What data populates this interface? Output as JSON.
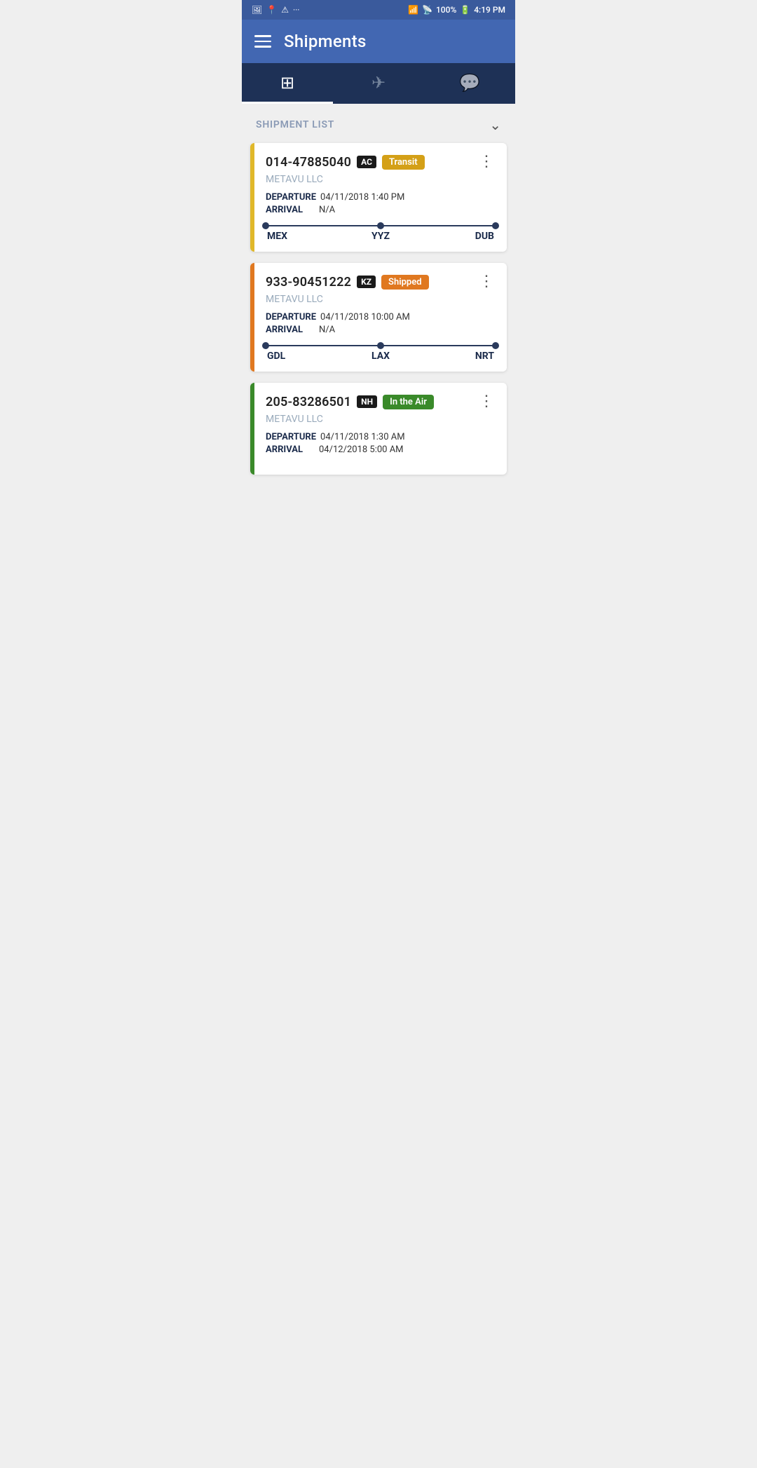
{
  "statusBar": {
    "time": "4:19 PM",
    "battery": "100%",
    "icons": [
      "image-icon",
      "location-icon",
      "warning-icon",
      "more-icon"
    ]
  },
  "header": {
    "title": "Shipments",
    "menuIcon": "hamburger-icon"
  },
  "tabs": [
    {
      "id": "dashboard",
      "icon": "grid-icon",
      "label": "Dashboard",
      "active": true
    },
    {
      "id": "flights",
      "icon": "airplane-icon",
      "label": "Flights",
      "active": false
    },
    {
      "id": "messages",
      "icon": "chat-icon",
      "label": "Messages",
      "active": false
    }
  ],
  "shipmentList": {
    "sectionTitle": "SHIPMENT LIST",
    "collapseIcon": "chevron-down"
  },
  "shipments": [
    {
      "id": "shipment-1",
      "trackingNumber": "014-47885040",
      "airlineBadge": "AC",
      "status": "Transit",
      "statusType": "transit",
      "company": "METAVU LLC",
      "departure": "04/11/2018 1:40 PM",
      "arrival": "N/A",
      "routeStart": "MEX",
      "routeMid": "YYZ",
      "routeEnd": "DUB",
      "cardColor": "transit"
    },
    {
      "id": "shipment-2",
      "trackingNumber": "933-90451222",
      "airlineBadge": "KZ",
      "status": "Shipped",
      "statusType": "shipped",
      "company": "METAVU LLC",
      "departure": "04/11/2018 10:00 AM",
      "arrival": "N/A",
      "routeStart": "GDL",
      "routeMid": "LAX",
      "routeEnd": "NRT",
      "cardColor": "shipped"
    },
    {
      "id": "shipment-3",
      "trackingNumber": "205-83286501",
      "airlineBadge": "NH",
      "status": "In the Air",
      "statusType": "in-the-air",
      "company": "METAVU LLC",
      "departure": "04/11/2018 1:30 AM",
      "arrival": "04/12/2018 5:00 AM",
      "routeStart": "",
      "routeMid": "",
      "routeEnd": "",
      "cardColor": "in-the-air"
    }
  ],
  "labels": {
    "departure": "DEPARTURE",
    "arrival": "ARRIVAL",
    "shipmentList": "SHIPMENT LIST"
  }
}
